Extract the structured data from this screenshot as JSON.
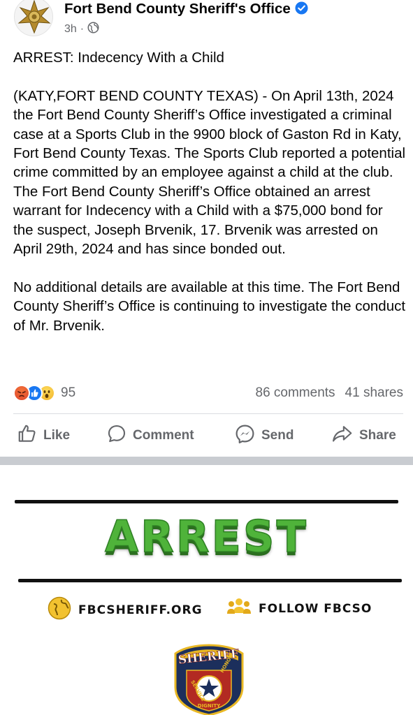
{
  "post": {
    "page_name": "Fort Bend County Sheriff's Office",
    "time": "3h",
    "dot": "·",
    "title": "ARREST: Indecency With a Child",
    "paragraph1": "(KATY,FORT BEND COUNTY TEXAS) - On April 13th, 2024 the Fort Bend County Sheriff’s Office investigated a criminal case at a Sports Club in the 9900 block of Gaston Rd in Katy, Fort Bend County Texas. The Sports Club reported a potential crime committed by an employee against a child at the club.  The Fort Bend County Sheriff’s Office obtained an arrest warrant for Indecency with a Child with a $75,000 bond for the suspect, Joseph Brvenik, 17. Brvenik was arrested on April 29th, 2024 and has since bonded out.",
    "paragraph2": "No additional details are available at this time. The Fort Bend County Sheriff’s Office is continuing to investigate the conduct of Mr. Brvenik."
  },
  "stats": {
    "reaction_count": "95",
    "comments": "86 comments",
    "shares": "41 shares",
    "reactions": [
      "angry",
      "like",
      "wow"
    ]
  },
  "actions": {
    "like": "Like",
    "comment": "Comment",
    "send": "Send",
    "share": "Share"
  },
  "graphic": {
    "headline": "ARREST",
    "website": "FBCSHERIFF.ORG",
    "follow": "FOLLOW FBCSO",
    "badge_top": "SHERIFF",
    "badge_left": "SERVICE",
    "badge_right": "HONOR",
    "badge_bottom": "DIGNITY"
  },
  "colors": {
    "brand_green": "#4fb33a",
    "facebook_blue": "#1877f2",
    "text_secondary": "#65676b",
    "badge_navy": "#1c2f5c",
    "badge_gold": "#e9b824"
  }
}
